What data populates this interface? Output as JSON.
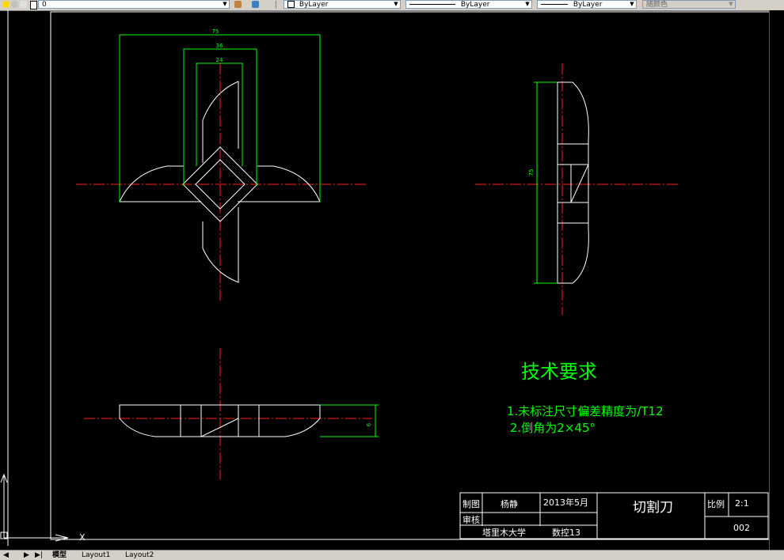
{
  "toolbar": {
    "layer_value": "0",
    "color_value": "ByLayer",
    "linetype_value": "ByLayer",
    "lineweight_value": "ByLayer",
    "plotstyle_value": "随颜色"
  },
  "dimensions": {
    "width_75": "75",
    "width_36": "36",
    "width_24": "24",
    "side_height": "75",
    "bottom_thickness": "6"
  },
  "notes": {
    "heading": "技术要求",
    "item1": "1.未标注尺寸偏差精度为/T12",
    "item2": "2.倒角为2×45°"
  },
  "title_block": {
    "draw_label": "制图",
    "drawer_name": "杨静",
    "date": "2013年5月",
    "part_name": "切割刀",
    "scale_label": "比例",
    "scale_value": "2:1",
    "check_label": "审核",
    "school": "塔里木大学",
    "class_name": "数控13",
    "drawing_number": "002"
  },
  "tabs": {
    "model": "模型",
    "layout1": "Layout1",
    "layout2": "Layout2"
  }
}
